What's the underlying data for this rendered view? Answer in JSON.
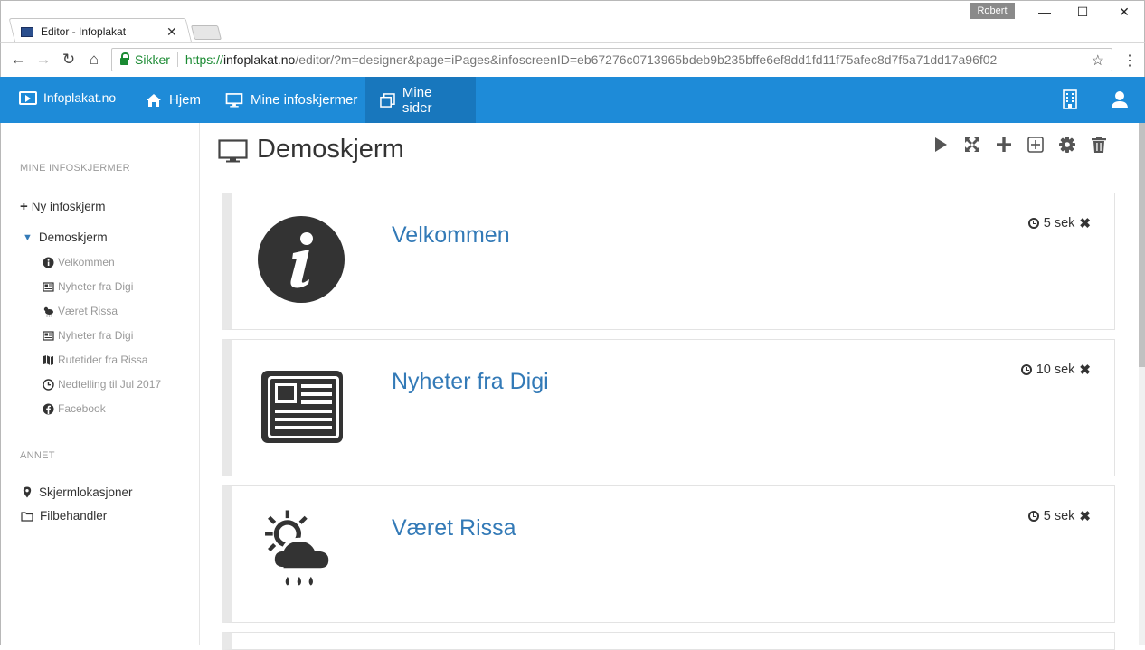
{
  "browser": {
    "tab_title": "Editor - Infoplakat",
    "profile": "Robert",
    "secure_label": "Sikker",
    "url_scheme": "https://",
    "url_host": "infoplakat.no",
    "url_rest": "/editor/?m=designer&page=iPages&infoscreenID=eb67276c0713965bdeb9b235bffe6ef8dd1fd11f75afec8d7f5a71dd17a96f02"
  },
  "header": {
    "brand": "Infoplakat.no",
    "nav": [
      {
        "label": "Hjem",
        "icon": "home-icon"
      },
      {
        "label": "Mine infoskjermer",
        "icon": "monitor-icon"
      },
      {
        "label": "Mine sider",
        "icon": "pages-icon"
      }
    ]
  },
  "sidebar": {
    "section1": "MINE INFOSKJERMER",
    "new_screen": "Ny infoskjerm",
    "screen": "Demoskjerm",
    "pages": [
      {
        "label": "Velkommen",
        "icon": "info-icon"
      },
      {
        "label": "Nyheter fra Digi",
        "icon": "newspaper-icon"
      },
      {
        "label": "Været Rissa",
        "icon": "weather-icon"
      },
      {
        "label": "Nyheter fra Digi",
        "icon": "newspaper-icon"
      },
      {
        "label": "Rutetider fra Rissa",
        "icon": "map-icon"
      },
      {
        "label": "Nedtelling til Jul 2017",
        "icon": "clock-icon"
      },
      {
        "label": "Facebook",
        "icon": "facebook-icon"
      }
    ],
    "section2": "ANNET",
    "other": [
      {
        "label": "Skjermlokasjoner",
        "icon": "map-marker-icon"
      },
      {
        "label": "Filbehandler",
        "icon": "folder-icon"
      }
    ]
  },
  "main": {
    "title": "Demoskjerm",
    "cards": [
      {
        "title": "Velkommen",
        "duration": "5 sek",
        "icon": "info-icon"
      },
      {
        "title": "Nyheter fra Digi",
        "duration": "10 sek",
        "icon": "newspaper-icon"
      },
      {
        "title": "Været Rissa",
        "duration": "5 sek",
        "icon": "weather-icon"
      }
    ]
  },
  "colors": {
    "accent": "#1e8bd8",
    "link": "#337ab7"
  }
}
